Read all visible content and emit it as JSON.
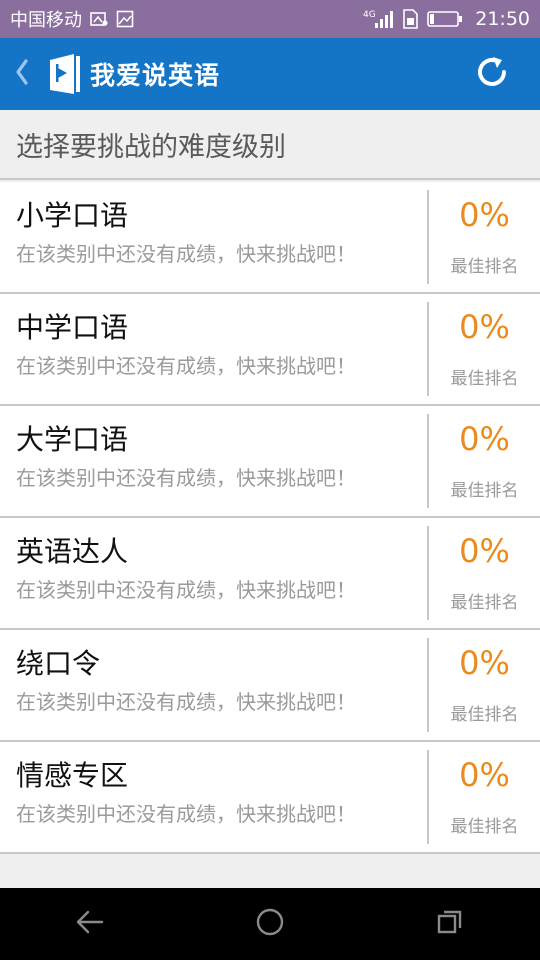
{
  "status_bar": {
    "carrier": "中国移动",
    "network": "4G",
    "time": "21:50"
  },
  "app_bar": {
    "title": "我爱说英语",
    "back_icon": "chevron-left-icon",
    "refresh_icon": "refresh-icon",
    "color": "#1474c6"
  },
  "section_header": "选择要挑战的难度级别",
  "list": [
    {
      "title": "小学口语",
      "subtitle": "在该类别中还没有成绩，快来挑战吧！",
      "percent": "0%",
      "rank_label": "最佳排名"
    },
    {
      "title": "中学口语",
      "subtitle": "在该类别中还没有成绩，快来挑战吧！",
      "percent": "0%",
      "rank_label": "最佳排名"
    },
    {
      "title": "大学口语",
      "subtitle": "在该类别中还没有成绩，快来挑战吧！",
      "percent": "0%",
      "rank_label": "最佳排名"
    },
    {
      "title": "英语达人",
      "subtitle": "在该类别中还没有成绩，快来挑战吧！",
      "percent": "0%",
      "rank_label": "最佳排名"
    },
    {
      "title": "绕口令",
      "subtitle": "在该类别中还没有成绩，快来挑战吧！",
      "percent": "0%",
      "rank_label": "最佳排名"
    },
    {
      "title": "情感专区",
      "subtitle": "在该类别中还没有成绩，快来挑战吧！",
      "percent": "0%",
      "rank_label": "最佳排名"
    }
  ],
  "colors": {
    "accent": "#ec8a1c",
    "status_bar": "#8a6f9e"
  }
}
